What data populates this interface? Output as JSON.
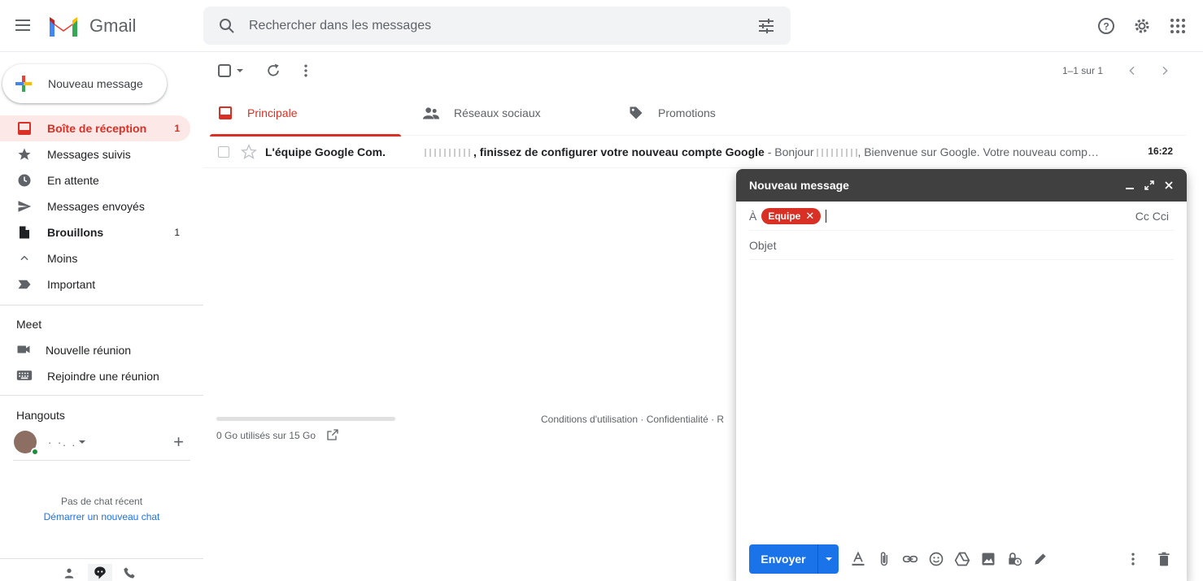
{
  "header": {
    "app_name": "Gmail",
    "search_placeholder": "Rechercher dans les messages"
  },
  "sidebar": {
    "compose_label": "Nouveau message",
    "items": [
      {
        "label": "Boîte de réception",
        "count": "1"
      },
      {
        "label": "Messages suivis",
        "count": ""
      },
      {
        "label": "En attente",
        "count": ""
      },
      {
        "label": "Messages envoyés",
        "count": ""
      },
      {
        "label": "Brouillons",
        "count": "1"
      },
      {
        "label": "Moins",
        "count": ""
      },
      {
        "label": "Important",
        "count": ""
      }
    ],
    "meet": {
      "title": "Meet",
      "new_meeting": "Nouvelle réunion",
      "join_meeting": "Rejoindre une réunion"
    },
    "hangouts": {
      "title": "Hangouts",
      "user_name": "· ·. .",
      "no_chat": "Pas de chat récent",
      "start_chat": "Démarrer un nouveau chat"
    }
  },
  "toolbar": {
    "pager": "1–1 sur 1"
  },
  "tabs": [
    {
      "label": "Principale"
    },
    {
      "label": "Réseaux sociaux"
    },
    {
      "label": "Promotions"
    }
  ],
  "inbox": {
    "rows": [
      {
        "sender": "L'équipe Google Com.",
        "subject": ", finissez de configurer votre nouveau compte Google",
        "snippet_prefix": " - Bonjour ",
        "snippet": ", Bienvenue sur Google. Votre nouveau comp…",
        "time": "16:22"
      }
    ]
  },
  "footer": {
    "storage": "0 Go utilisés sur 15 Go",
    "links": "Conditions d'utilisation · Confidentialité · R"
  },
  "compose": {
    "title": "Nouveau message",
    "to_label": "À",
    "recipient_chip": "Equipe",
    "cc_label": "Cc Cci",
    "subject_placeholder": "Objet",
    "send_label": "Envoyer"
  },
  "colors": {
    "accent_red": "#d93025",
    "send_blue": "#1a73e8",
    "compose_header": "#404040"
  }
}
